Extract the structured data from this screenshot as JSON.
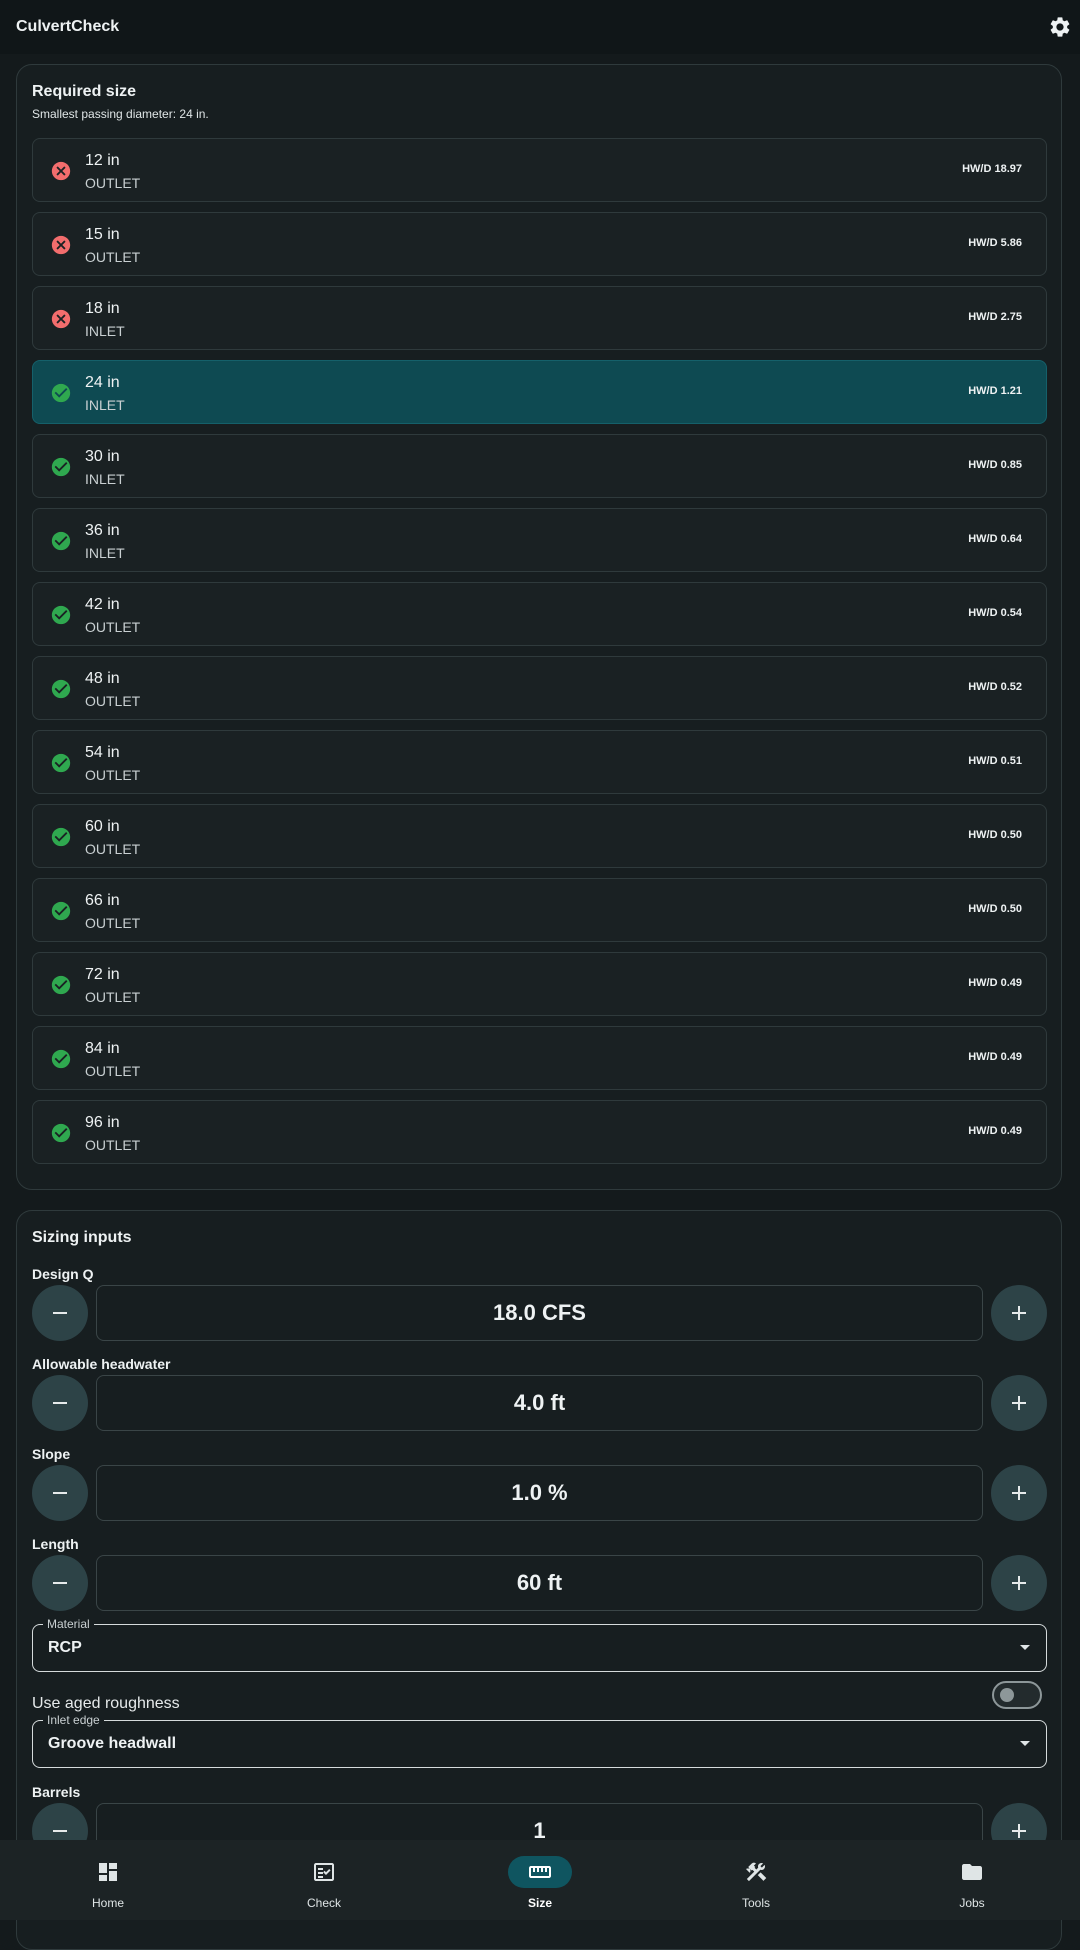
{
  "app": {
    "title": "CulvertCheck"
  },
  "required_size": {
    "title": "Required size",
    "subtitle": "Smallest passing diameter: 24 in.",
    "rows": [
      {
        "size": "12 in",
        "control": "OUTLET",
        "hwd": "HW/D 18.97",
        "status": "fail",
        "selected": false
      },
      {
        "size": "15 in",
        "control": "OUTLET",
        "hwd": "HW/D 5.86",
        "status": "fail",
        "selected": false
      },
      {
        "size": "18 in",
        "control": "INLET",
        "hwd": "HW/D 2.75",
        "status": "fail",
        "selected": false
      },
      {
        "size": "24 in",
        "control": "INLET",
        "hwd": "HW/D 1.21",
        "status": "pass",
        "selected": true
      },
      {
        "size": "30 in",
        "control": "INLET",
        "hwd": "HW/D 0.85",
        "status": "pass",
        "selected": false
      },
      {
        "size": "36 in",
        "control": "INLET",
        "hwd": "HW/D 0.64",
        "status": "pass",
        "selected": false
      },
      {
        "size": "42 in",
        "control": "OUTLET",
        "hwd": "HW/D 0.54",
        "status": "pass",
        "selected": false
      },
      {
        "size": "48 in",
        "control": "OUTLET",
        "hwd": "HW/D 0.52",
        "status": "pass",
        "selected": false
      },
      {
        "size": "54 in",
        "control": "OUTLET",
        "hwd": "HW/D 0.51",
        "status": "pass",
        "selected": false
      },
      {
        "size": "60 in",
        "control": "OUTLET",
        "hwd": "HW/D 0.50",
        "status": "pass",
        "selected": false
      },
      {
        "size": "66 in",
        "control": "OUTLET",
        "hwd": "HW/D 0.50",
        "status": "pass",
        "selected": false
      },
      {
        "size": "72 in",
        "control": "OUTLET",
        "hwd": "HW/D 0.49",
        "status": "pass",
        "selected": false
      },
      {
        "size": "84 in",
        "control": "OUTLET",
        "hwd": "HW/D 0.49",
        "status": "pass",
        "selected": false
      },
      {
        "size": "96 in",
        "control": "OUTLET",
        "hwd": "HW/D 0.49",
        "status": "pass",
        "selected": false
      }
    ]
  },
  "sizing_inputs": {
    "title": "Sizing inputs",
    "design_q": {
      "label": "Design Q",
      "value": "18.0 CFS"
    },
    "headwater": {
      "label": "Allowable headwater",
      "value": "4.0 ft"
    },
    "slope": {
      "label": "Slope",
      "value": "1.0 %"
    },
    "length": {
      "label": "Length",
      "value": "60 ft"
    },
    "material": {
      "label": "Material",
      "value": "RCP"
    },
    "aged_roughness": {
      "label": "Use aged roughness",
      "on": false
    },
    "inlet_edge": {
      "label": "Inlet edge",
      "value": "Groove headwall"
    },
    "barrels": {
      "label": "Barrels",
      "value": "1"
    }
  },
  "nav": {
    "active": "Size",
    "items": [
      {
        "label": "Home",
        "icon": "dashboard-icon"
      },
      {
        "label": "Check",
        "icon": "fact-check-icon"
      },
      {
        "label": "Size",
        "icon": "ruler-icon"
      },
      {
        "label": "Tools",
        "icon": "tools-icon"
      },
      {
        "label": "Jobs",
        "icon": "folder-icon"
      }
    ]
  },
  "colors": {
    "pass": "#2fa84f",
    "fail": "#f26d6d",
    "selected_row": "#0e4a52",
    "accent": "#0f5560",
    "background": "#141a1c"
  }
}
